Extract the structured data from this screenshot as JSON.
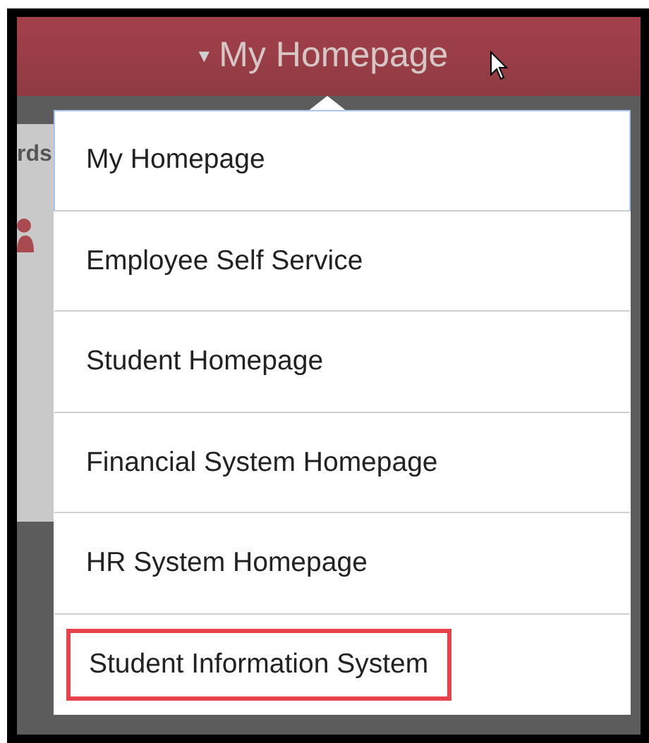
{
  "header": {
    "caret": "▼",
    "title": "My Homepage"
  },
  "background_tile": {
    "label": "rds"
  },
  "menu": {
    "items": [
      {
        "label": "My Homepage",
        "selected": true,
        "highlighted": false
      },
      {
        "label": "Employee Self Service",
        "selected": false,
        "highlighted": false
      },
      {
        "label": "Student Homepage",
        "selected": false,
        "highlighted": false
      },
      {
        "label": "Financial System Homepage",
        "selected": false,
        "highlighted": false
      },
      {
        "label": "HR System Homepage",
        "selected": false,
        "highlighted": false
      },
      {
        "label": "Student Information System",
        "selected": false,
        "highlighted": true
      }
    ]
  }
}
